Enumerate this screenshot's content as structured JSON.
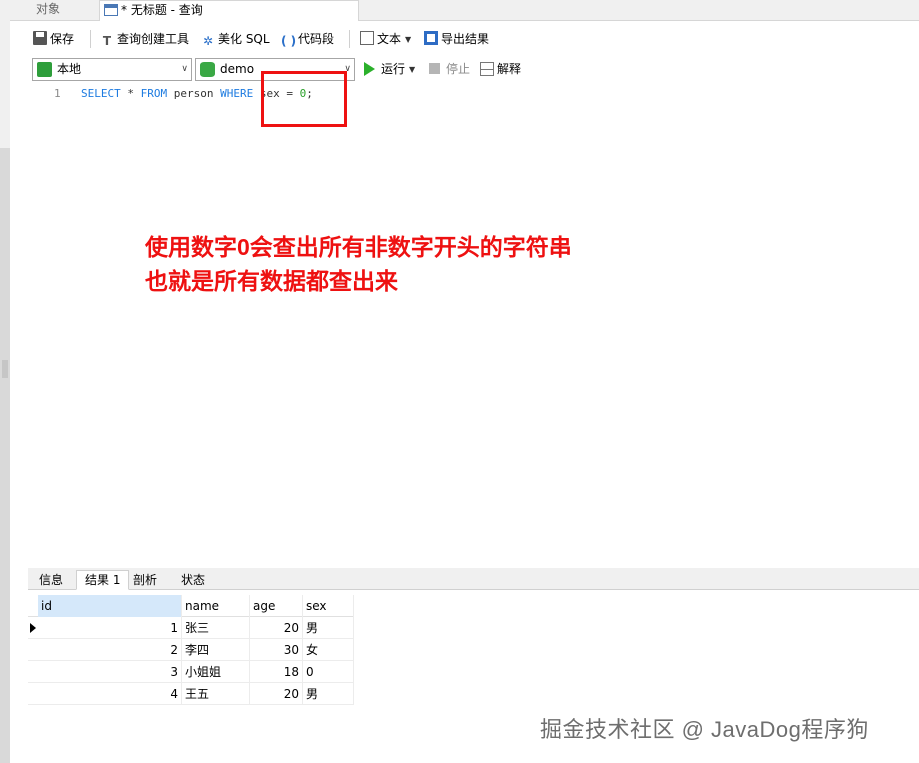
{
  "tabs": {
    "objects_label": "对象",
    "query_label": "* 无标题 - 查询"
  },
  "toolbar": {
    "save_label": "保存",
    "query_builder_label": "查询创建工具",
    "beautify_label": "美化 SQL",
    "code_snippet_label": "代码段",
    "text_label": "文本",
    "export_label": "导出结果"
  },
  "connection": {
    "selected": "本地"
  },
  "database": {
    "selected": "demo"
  },
  "run": {
    "run_label": "运行",
    "stop_label": "停止",
    "explain_label": "解释"
  },
  "editor": {
    "line_number": "1",
    "tokens": {
      "select": "SELECT",
      "star": " * ",
      "from": "FROM",
      "table": " person ",
      "where": "WHERE",
      "cond": " sex = ",
      "value": "0",
      "end": ";"
    }
  },
  "annotation": {
    "line1": "使用数字0会查出所有非数字开头的字符串",
    "line2": "也就是所有数据都查出来"
  },
  "result_tabs": [
    "信息",
    "结果 1",
    "剖析",
    "状态"
  ],
  "grid": {
    "columns": [
      "id",
      "name",
      "age",
      "sex"
    ],
    "rows": [
      [
        "1",
        "张三",
        "20",
        "男"
      ],
      [
        "2",
        "李四",
        "30",
        "女"
      ],
      [
        "3",
        "小姐姐",
        "18",
        "0"
      ],
      [
        "4",
        "王五",
        "20",
        "男"
      ]
    ]
  },
  "watermark": "掘金技术社区 @ JavaDog程序狗",
  "colors": {
    "annotation_red": "#ee1111",
    "keyword_blue": "#1d7be0",
    "number_green": "#2aa02a",
    "run_green": "#2bb02b"
  }
}
